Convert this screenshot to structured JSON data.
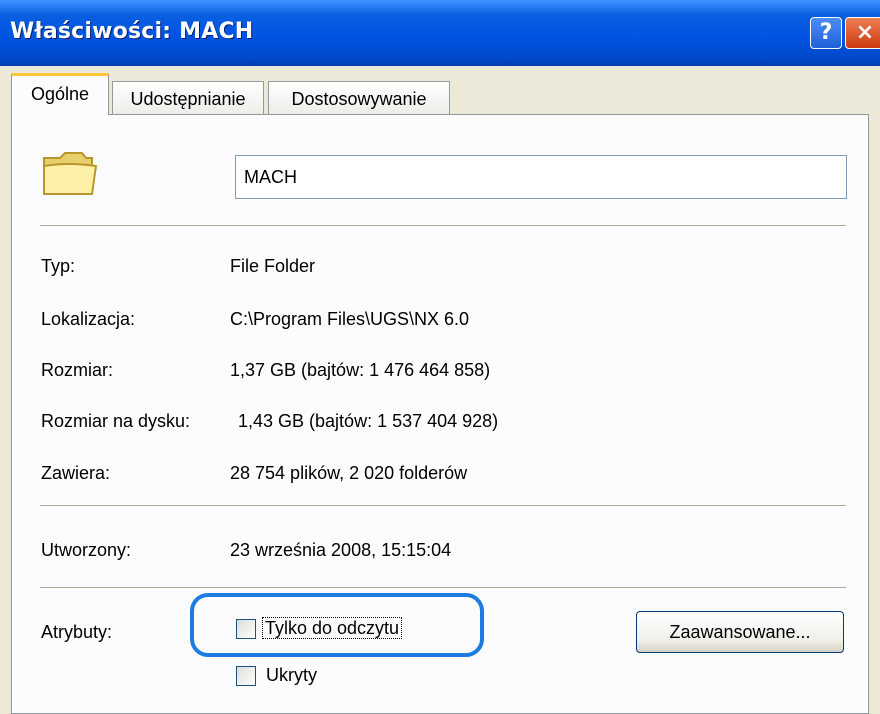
{
  "window": {
    "title": "Właściwości: MACH",
    "help_label": "?",
    "close_label": "×"
  },
  "tabs": [
    {
      "label": "Ogólne",
      "active": true
    },
    {
      "label": "Udostępnianie",
      "active": false
    },
    {
      "label": "Dostosowywanie",
      "active": false
    }
  ],
  "general": {
    "folder_icon": "folder-icon",
    "name_value": "MACH",
    "rows": [
      {
        "label": "Typ:",
        "value": "File Folder"
      },
      {
        "label": "Lokalizacja:",
        "value": "C:\\Program Files\\UGS\\NX 6.0"
      },
      {
        "label": "Rozmiar:",
        "value": "1,37 GB (bajtów: 1 476 464 858)"
      },
      {
        "label": "Rozmiar na dysku:",
        "value": "1,43 GB (bajtów: 1 537 404 928)"
      },
      {
        "label": "Zawiera:",
        "value": "28 754 plików, 2 020 folderów"
      }
    ],
    "created": {
      "label": "Utworzony:",
      "value": "23 września 2008, 15:15:04"
    },
    "attributes": {
      "label": "Atrybuty:",
      "readonly": {
        "label": "Tylko do odczytu",
        "checked": false
      },
      "hidden": {
        "label": "Ukryty",
        "checked": false
      },
      "advanced_label": "Zaawansowane..."
    }
  },
  "colors": {
    "titlebar": "#0054E3",
    "highlight_outline": "#1C7BE0",
    "active_tab_accent": "#FFC83C"
  }
}
